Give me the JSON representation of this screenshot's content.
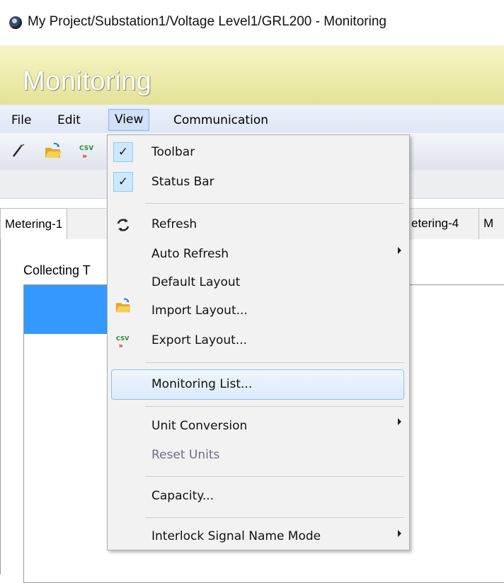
{
  "window": {
    "title": "My Project/Substation1/Voltage Level1/GRL200 - Monitoring"
  },
  "banner": {
    "title": "Monitoring"
  },
  "menubar": {
    "items": [
      {
        "label": "File"
      },
      {
        "label": "Edit"
      },
      {
        "label": "View",
        "active": true
      },
      {
        "label": "Communication"
      }
    ]
  },
  "toolbar": {
    "icons": [
      "edit-icon",
      "open-folder-icon",
      "csv-export-icon"
    ]
  },
  "tabs": {
    "items": [
      {
        "label": "Metering-1"
      },
      {
        "label": "etering-4"
      },
      {
        "label": "M"
      }
    ]
  },
  "content": {
    "status_text": "Collecting T"
  },
  "view_menu": {
    "items": [
      {
        "label": "Toolbar",
        "checked": true
      },
      {
        "label": "Status Bar",
        "checked": true
      },
      {
        "label": "Refresh",
        "icon": "refresh-icon"
      },
      {
        "label": "Auto Refresh",
        "submenu": true
      },
      {
        "label": "Default Layout"
      },
      {
        "label": "Import Layout...",
        "icon": "open-folder-icon"
      },
      {
        "label": "Export Layout...",
        "icon": "csv-export-icon"
      },
      {
        "label": "Monitoring List...",
        "highlighted": true
      },
      {
        "label": "Unit Conversion",
        "submenu": true
      },
      {
        "label": "Reset Units",
        "disabled": true
      },
      {
        "label": "Capacity..."
      },
      {
        "label": "Interlock Signal Name Mode",
        "submenu": true
      }
    ]
  },
  "colors": {
    "banner": "#ecebab",
    "menu_highlight": "#dcebfb",
    "list_selection": "#3399ff"
  }
}
